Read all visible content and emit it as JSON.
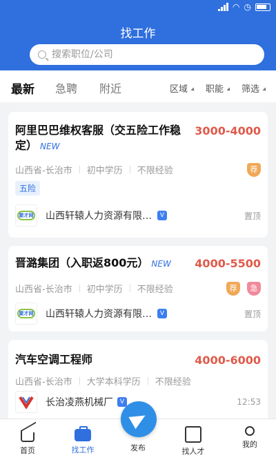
{
  "app": {
    "title": "找工作"
  },
  "search": {
    "placeholder": "搜索职位/公司"
  },
  "tabs": [
    {
      "label": "最新",
      "active": true
    },
    {
      "label": "急聘",
      "active": false
    },
    {
      "label": "附近",
      "active": false
    }
  ],
  "filters": [
    {
      "label": "区域"
    },
    {
      "label": "职能"
    },
    {
      "label": "筛选"
    }
  ],
  "jobs": [
    {
      "title_line1": "阿里巴巴维权客服（交五险工作稳",
      "title_line2": "定）",
      "new_tag": "NEW",
      "salary": "3000-4000",
      "location": "山西省-长治市",
      "education": "初中学历",
      "experience": "不限经验",
      "benefit": "五险",
      "badges": [
        "荐"
      ],
      "company": "山西轩辕人力资源有限公司",
      "right_text": "置顶"
    },
    {
      "title_line1": "晋潞集团（入职返800元）",
      "new_tag": "NEW",
      "salary": "4000-5500",
      "location": "山西省-长治市",
      "education": "初中学历",
      "experience": "不限经验",
      "badges": [
        "荐",
        "急"
      ],
      "company": "山西轩辕人力资源有限公司",
      "right_text": "置顶"
    },
    {
      "title_line1": "汽车空调工程师",
      "salary": "4000-6000",
      "location": "山西省-长治市",
      "education": "大学本科学历",
      "experience": "不限经验",
      "company": "长治凌燕机械厂",
      "right_text": "12:53"
    }
  ],
  "logo_text": "聚才网",
  "verified_mark": "V",
  "nav": [
    {
      "label": "首页",
      "icon": "home-icon",
      "active": false
    },
    {
      "label": "找工作",
      "icon": "briefcase-icon",
      "active": true
    },
    {
      "label": "发布",
      "icon": "paper-plane-icon",
      "active": false
    },
    {
      "label": "找人才",
      "icon": "find-talent-icon",
      "active": false
    },
    {
      "label": "我的",
      "icon": "user-icon",
      "active": false
    }
  ],
  "colors": {
    "brand": "#2f6fde",
    "salary": "#e05a4a",
    "recommend": "#f0a857",
    "urgent": "#f08a9a"
  }
}
